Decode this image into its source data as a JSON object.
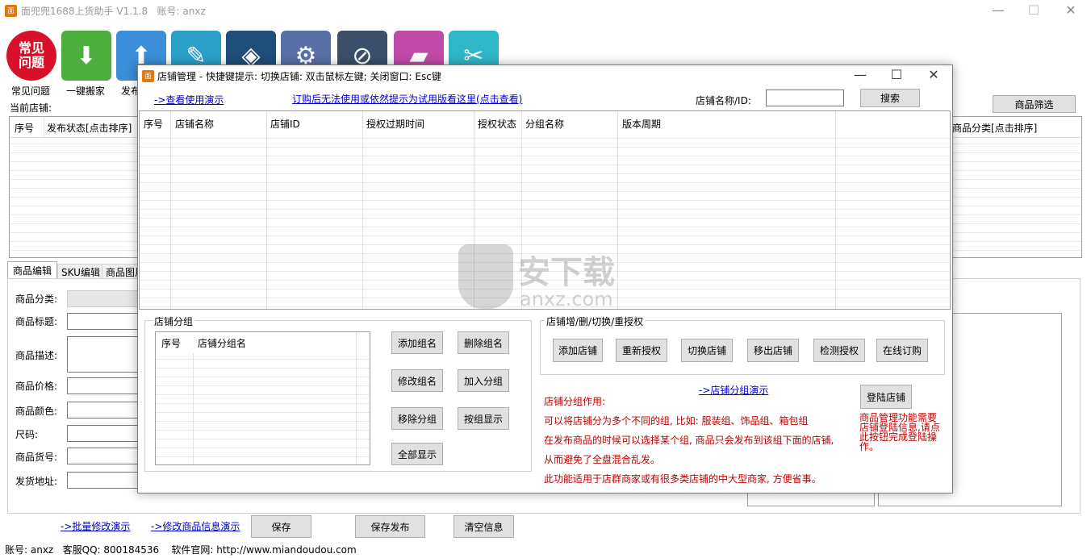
{
  "main_window": {
    "title": "面兜兜1688上货助手 V1.1.8   账号: anxz",
    "controls": {
      "minimize": "—",
      "maximize": "☐",
      "close": "✕"
    },
    "toolbar": [
      {
        "label": "常见问题",
        "icon": "faq-icon",
        "icon_text": "常见\n问题",
        "color": "#d9102a"
      },
      {
        "label": "一键搬家",
        "icon": "download-icon",
        "color": "#4caf3d"
      },
      {
        "label": "发布",
        "icon": "upload-icon",
        "color": "#3b8ed8"
      },
      {
        "label": "",
        "icon": "notepad-icon",
        "color": "#2aa0c8"
      },
      {
        "label": "",
        "icon": "layers-icon",
        "color": "#1f4e7a"
      },
      {
        "label": "",
        "icon": "gear-icon",
        "color": "#5a6fa8"
      },
      {
        "label": "",
        "icon": "forbidden-icon",
        "color": "#3b4f6a"
      },
      {
        "label": "",
        "icon": "folder-icon",
        "color": "#c04aa8"
      },
      {
        "label": "",
        "icon": "tools-icon",
        "color": "#2fb6c8"
      }
    ],
    "current_shop_label": "当前店铺:",
    "product_filter_button": "商品筛选",
    "product_table": {
      "col_index": "序号",
      "col_status": "发布状态[点击排序]",
      "col_category": "商品分类[点击排序]"
    },
    "tabs": [
      "商品编辑",
      "SKU编辑",
      "商品图片"
    ],
    "form_labels": [
      "商品分类:",
      "商品标题:",
      "商品描述:",
      "商品价格:",
      "商品颜色:",
      "尺码:",
      "商品货号:",
      "发货地址:"
    ],
    "bottom_links": [
      "->批量修改演示",
      "->修改商品信息演示"
    ],
    "bottom_buttons": [
      "保存",
      "保存发布",
      "清空信息"
    ],
    "status_bar": "账号: anxz   客服QQ: 800184536    软件官网: http://www.miandoudou.com"
  },
  "dialog": {
    "title": "店铺管理 - 快捷键提示: 切换店铺: 双击鼠标左键; 关闭窗口: Esc键",
    "controls": {
      "minimize": "—",
      "maximize": "☐",
      "close": "✕"
    },
    "link_demo": "->查看使用演示",
    "link_notice": "订购后无法使用或依然提示为试用版看这里(点击查看)",
    "search_label": "店铺名称/ID:",
    "search_value": "",
    "search_button": "搜索",
    "shop_table_headers": [
      "序号",
      "店铺名称",
      "店铺ID",
      "授权过期时间",
      "授权状态",
      "分组名称",
      "版本周期"
    ],
    "group_section_title": "店铺分组",
    "group_table_headers": [
      "序号",
      "店铺分组名"
    ],
    "group_buttons": [
      "添加组名",
      "删除组名",
      "修改组名",
      "加入分组",
      "移除分组",
      "按组显示",
      "全部显示"
    ],
    "shop_ops_title": "店铺增/删/切换/重授权",
    "shop_ops_buttons": [
      "添加店铺",
      "重新授权",
      "切换店铺",
      "移出店铺",
      "检测授权",
      "在线订购"
    ],
    "link_group_demo": "->店铺分组演示",
    "login_button": "登陆店铺",
    "login_note": "商品管理功能需要店铺登陆信息,请点此按钮完成登陆操作。",
    "group_info": [
      "店铺分组作用:",
      "可以将店铺分为多个不同的组, 比如: 服装组、饰品组、箱包组",
      "在发布商品的时候可以选择某个组, 商品只会发布到该组下面的店铺,",
      "从而避免了全盘混合乱发。",
      "此功能适用于店群商家或有很多类店铺的中大型商家, 方便省事。"
    ]
  },
  "watermark": {
    "name": "安下载",
    "domain": "anxz.com"
  }
}
